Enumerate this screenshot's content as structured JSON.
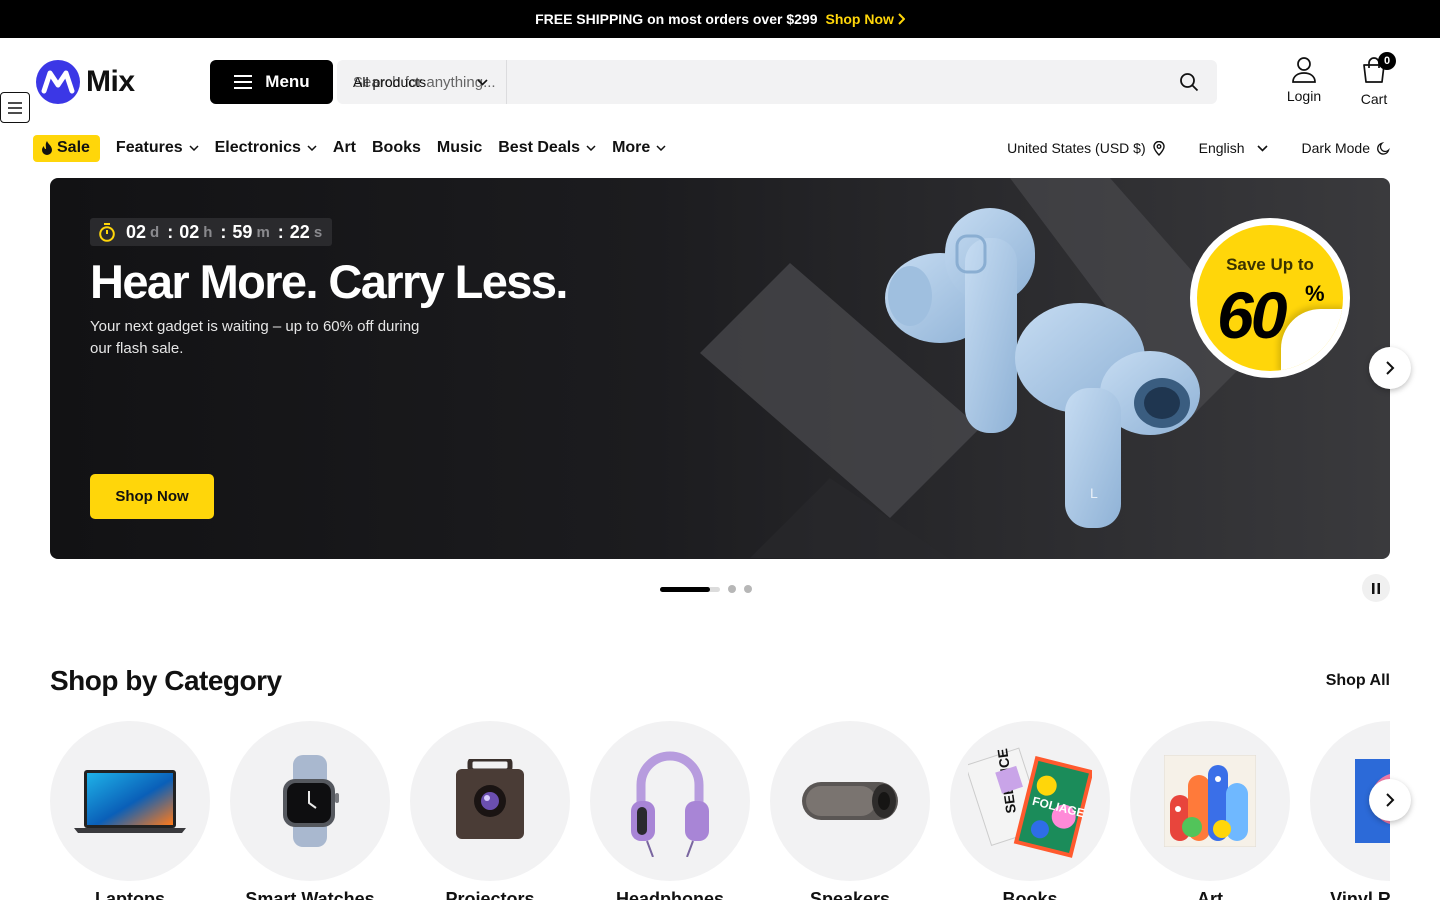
{
  "announcement": {
    "text": "FREE SHIPPING on most orders over $299",
    "link_label": "Shop Now"
  },
  "header": {
    "brand": "Mix",
    "menu_label": "Menu",
    "search": {
      "category": "All products",
      "placeholder": "Search for anything..."
    },
    "account_label": "Login",
    "cart_label": "Cart",
    "cart_count": "0"
  },
  "nav": {
    "sale_label": "Sale",
    "items": [
      {
        "label": "Features",
        "dropdown": true
      },
      {
        "label": "Electronics",
        "dropdown": true
      },
      {
        "label": "Art",
        "dropdown": false
      },
      {
        "label": "Books",
        "dropdown": false
      },
      {
        "label": "Music",
        "dropdown": false
      },
      {
        "label": "Best Deals",
        "dropdown": true
      },
      {
        "label": "More",
        "dropdown": true
      }
    ],
    "region": "United States (USD $)",
    "language": "English",
    "dark_mode": "Dark Mode"
  },
  "hero": {
    "countdown": {
      "days": "02",
      "days_unit": "d",
      "hours": "02",
      "hours_unit": "h",
      "minutes": "59",
      "minutes_unit": "m",
      "seconds": "22",
      "seconds_unit": "s"
    },
    "title": "Hear More. Carry Less.",
    "subtitle": "Your next gadget is waiting – up to 60% off during our flash sale.",
    "cta": "Shop Now",
    "sticker_top": "Save Up to",
    "sticker_value": "60",
    "sticker_unit": "%",
    "slide_progress": 0.83,
    "slide_count": 3,
    "active_slide": 1
  },
  "categories": {
    "title": "Shop by Category",
    "shop_all": "Shop All",
    "items": [
      {
        "label": "Laptops",
        "icon": "laptop-icon"
      },
      {
        "label": "Smart Watches",
        "icon": "smart-watch-icon"
      },
      {
        "label": "Projectors",
        "icon": "projector-icon"
      },
      {
        "label": "Headphones",
        "icon": "headphones-icon"
      },
      {
        "label": "Speakers",
        "icon": "speaker-icon"
      },
      {
        "label": "Books",
        "icon": "books-icon"
      },
      {
        "label": "Art",
        "icon": "art-icon"
      },
      {
        "label": "Vinyl Records",
        "icon": "vinyl-icon"
      }
    ]
  },
  "colors": {
    "accent": "#ffd60a",
    "brand": "#3b37e6",
    "announcement_bg": "#000000",
    "hero_bg": "#1c1c1f",
    "earbuds": "#a9c7e6"
  }
}
